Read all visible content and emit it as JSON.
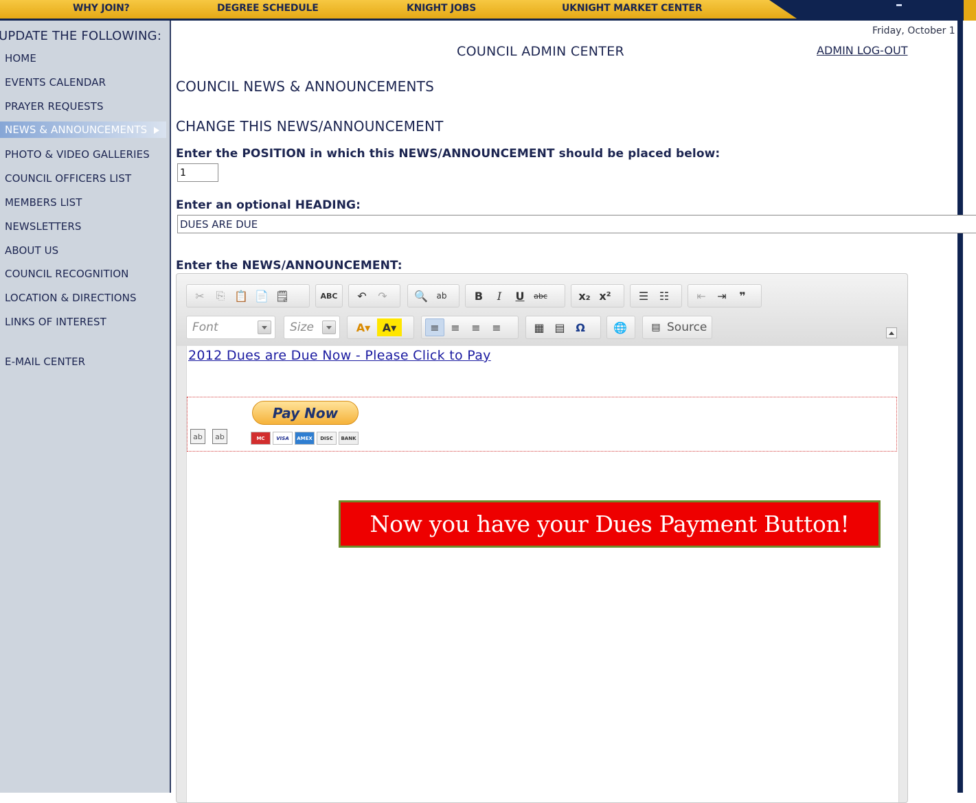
{
  "topnav": {
    "links": [
      "WHY JOIN?",
      "DEGREE SCHEDULE",
      "KNIGHT JOBS",
      "UKNIGHT MARKET CENTER"
    ]
  },
  "sidebar": {
    "heading": "UPDATE THE FOLLOWING:",
    "items": [
      {
        "label": "HOME"
      },
      {
        "label": "EVENTS CALENDAR"
      },
      {
        "label": "PRAYER REQUESTS"
      },
      {
        "label": "NEWS & ANNOUNCEMENTS",
        "active": true
      },
      {
        "label": "PHOTO & VIDEO GALLERIES"
      },
      {
        "label": "COUNCIL OFFICERS LIST"
      },
      {
        "label": "MEMBERS LIST"
      },
      {
        "label": "NEWSLETTERS"
      },
      {
        "label": "ABOUT US"
      },
      {
        "label": "COUNCIL RECOGNITION"
      },
      {
        "label": "LOCATION & DIRECTIONS"
      },
      {
        "label": "LINKS OF INTEREST"
      },
      {
        "label": "E-MAIL CENTER"
      }
    ]
  },
  "header": {
    "date": "Friday, October 1",
    "title": "COUNCIL ADMIN CENTER",
    "logout": "ADMIN LOG-OUT"
  },
  "main": {
    "section_title": "COUNCIL NEWS & ANNOUNCEMENTS",
    "subsection_title": "CHANGE THIS NEWS/ANNOUNCEMENT",
    "position_label": "Enter the POSITION in which this NEWS/ANNOUNCEMENT should be placed below:",
    "position_value": "1",
    "heading_label": "Enter an optional HEADING:",
    "heading_value": "DUES ARE DUE",
    "news_label": "Enter the NEWS/ANNOUNCEMENT:"
  },
  "editor": {
    "font_placeholder": "Font",
    "size_placeholder": "Size",
    "source_label": "Source",
    "content_link": "2012 Dues are Due Now - Please Click to Pay",
    "paynow_label": "Pay Now",
    "hidden_field_label": "ab",
    "cards": [
      "MC",
      "VISA",
      "AMEX",
      "DISC",
      "BANK"
    ]
  },
  "callout": {
    "text": "Now you have your Dues Payment Button!"
  },
  "colors": {
    "nav_gold": "#f0be2e",
    "nav_navy": "#0f2350",
    "sidebar_bg": "#ced5de",
    "link_blue": "#1a1aa0",
    "callout_red": "#ee0000",
    "callout_border": "#6e8a2a"
  }
}
